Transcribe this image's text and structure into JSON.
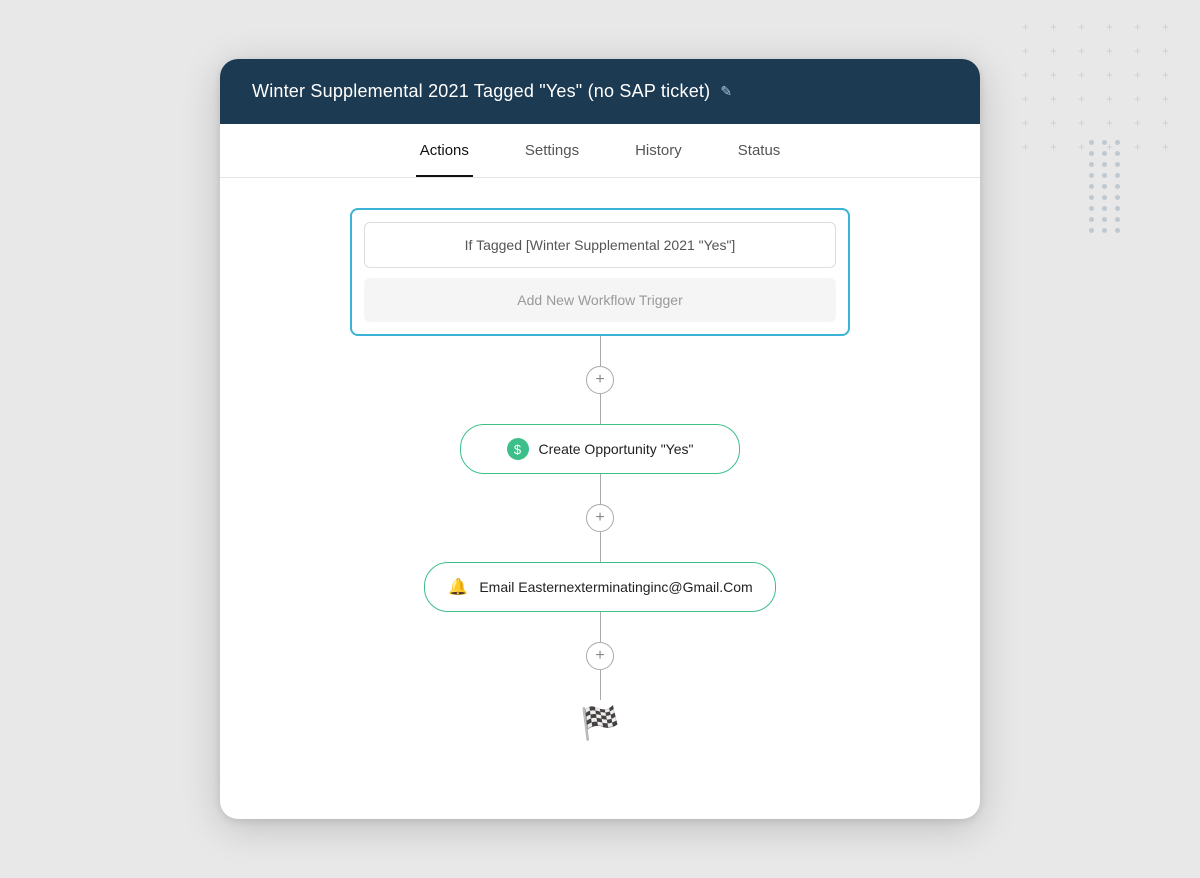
{
  "card": {
    "title": "Winter Supplemental 2021 Tagged \"Yes\" (no SAP ticket)",
    "edit_icon": "✎"
  },
  "tabs": [
    {
      "label": "Actions",
      "active": true
    },
    {
      "label": "Settings",
      "active": false
    },
    {
      "label": "History",
      "active": false
    },
    {
      "label": "Status",
      "active": false
    }
  ],
  "trigger": {
    "condition_label": "If Tagged [Winter Supplemental 2021 \"Yes\"]",
    "add_trigger_label": "Add New Workflow Trigger"
  },
  "actions": [
    {
      "icon_type": "green-circle",
      "icon_text": "$",
      "label": "Create Opportunity \"Yes\""
    },
    {
      "icon_type": "bell-green",
      "icon_text": "🔔",
      "label": "Email Easternexterminatinginc@Gmail.Com"
    }
  ],
  "connectors": {
    "add_icon": "+"
  },
  "finish": {
    "icon": "🏁"
  }
}
